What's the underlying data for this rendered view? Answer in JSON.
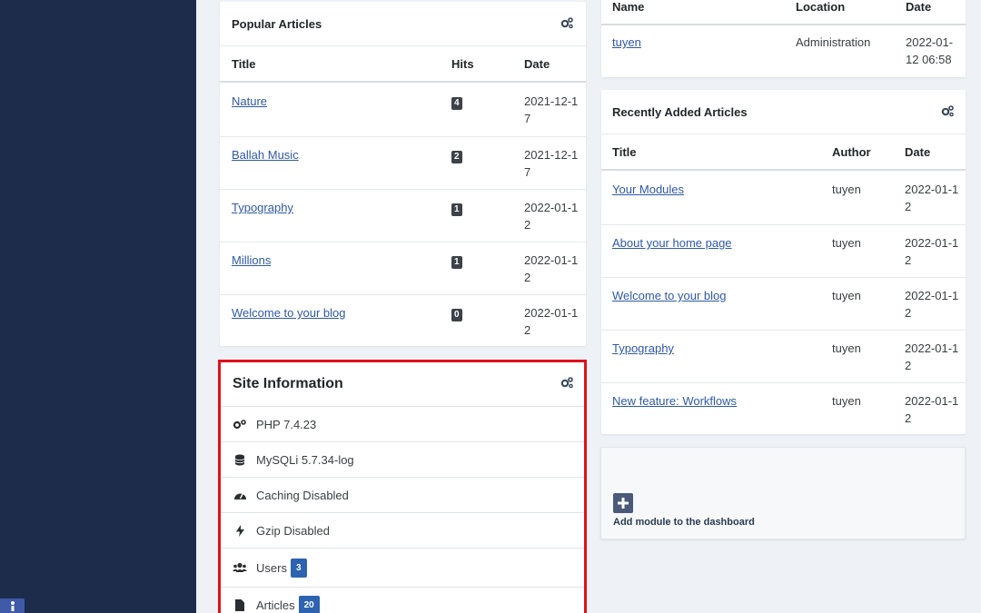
{
  "popular": {
    "title": "Popular Articles",
    "headers": {
      "title": "Title",
      "hits": "Hits",
      "date": "Date"
    },
    "rows": [
      {
        "title": "Nature",
        "hits": "4",
        "date": "2021-12-17"
      },
      {
        "title": "Ballah Music",
        "hits": "2",
        "date": "2021-12-17"
      },
      {
        "title": "Typography",
        "hits": "1",
        "date": "2022-01-12"
      },
      {
        "title": "Millions",
        "hits": "1",
        "date": "2022-01-12"
      },
      {
        "title": "Welcome to your blog",
        "hits": "0",
        "date": "2022-01-12"
      }
    ]
  },
  "logged": {
    "headers": {
      "name": "Name",
      "location": "Location",
      "date": "Date"
    },
    "rows": [
      {
        "name": "tuyen",
        "location": "Administration",
        "date": "2022-01-12 06:58"
      }
    ]
  },
  "recent": {
    "title": "Recently Added Articles",
    "headers": {
      "title": "Title",
      "author": "Author",
      "date": "Date"
    },
    "rows": [
      {
        "title": "Your Modules",
        "author": "tuyen",
        "date": "2022-01-12"
      },
      {
        "title": "About your home page",
        "author": "tuyen",
        "date": "2022-01-12"
      },
      {
        "title": "Welcome to your blog",
        "author": "tuyen",
        "date": "2022-01-12"
      },
      {
        "title": "Typography",
        "author": "tuyen",
        "date": "2022-01-12"
      },
      {
        "title": "New feature: Workflows",
        "author": "tuyen",
        "date": "2022-01-12"
      }
    ]
  },
  "siteinfo": {
    "title": "Site Information",
    "items": {
      "php": "PHP 7.4.23",
      "mysql": "MySQLi 5.7.34-log",
      "caching": "Caching Disabled",
      "gzip": "Gzip Disabled",
      "users": "Users",
      "users_count": "3",
      "articles": "Articles",
      "articles_count": "20"
    }
  },
  "add_module": {
    "label": "Add module to the dashboard"
  },
  "colors": {
    "sidebar": "#1c2c4a",
    "link": "#2e59a8",
    "badge_blue": "#2d63b0",
    "highlight": "#e0111b"
  }
}
